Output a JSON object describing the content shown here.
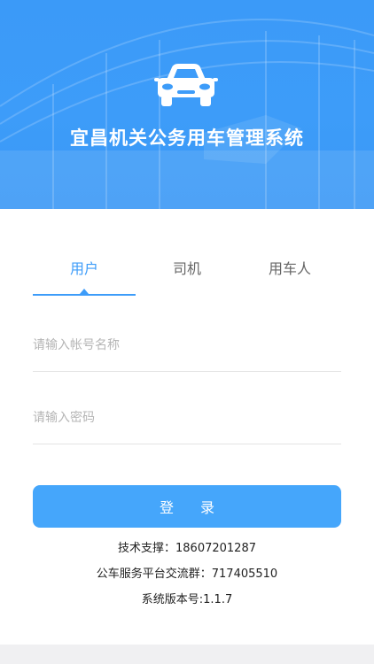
{
  "header": {
    "app_title": "宜昌机关公务用车管理系统",
    "icon": "car-icon",
    "accent_color": "#3d9cf9"
  },
  "tabs": [
    {
      "label": "用户",
      "active": true
    },
    {
      "label": "司机",
      "active": false
    },
    {
      "label": "用车人",
      "active": false
    }
  ],
  "form": {
    "username_placeholder": "请输入帐号名称",
    "username_value": "",
    "password_placeholder": "请输入密码",
    "password_value": "",
    "login_label": "登录"
  },
  "info": {
    "tech_support": "技术支撑：18607201287",
    "group": "公车服务平台交流群：717405510",
    "version": "系统版本号:1.1.7"
  }
}
